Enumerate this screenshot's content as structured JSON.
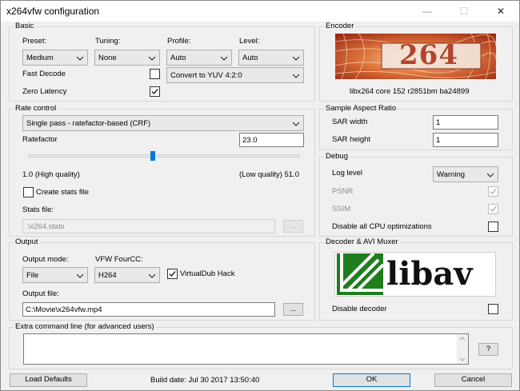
{
  "window": {
    "title": "x264vfw configuration",
    "minimize_glyph": "—",
    "maximize_glyph": "☐",
    "close_glyph": "✕"
  },
  "basic": {
    "title": "Basic",
    "preset_label": "Preset:",
    "preset_value": "Medium",
    "tuning_label": "Tuning:",
    "tuning_value": "None",
    "profile_label": "Profile:",
    "profile_value": "Auto",
    "level_label": "Level:",
    "level_value": "Auto",
    "fast_decode_label": "Fast Decode",
    "fast_decode_checked": false,
    "zero_latency_label": "Zero Latency",
    "zero_latency_checked": true,
    "colorspace_value": "Convert to YUV 4:2:0"
  },
  "encoder": {
    "title": "Encoder",
    "logo_text": "264",
    "version_text": "libx264 core 152 r2851bm ba24899"
  },
  "rate_control": {
    "title": "Rate control",
    "mode_value": "Single pass - ratefactor-based (CRF)",
    "ratefactor_label": "Ratefactor",
    "ratefactor_value": "23.0",
    "slider_level": 0.46,
    "min_label": "1.0 (High quality)",
    "max_label": "(Low quality) 51.0",
    "create_stats_label": "Create stats file",
    "create_stats_checked": false,
    "stats_file_label": "Stats file:",
    "stats_file_value": ".\\x264.stats",
    "browse_label": "..."
  },
  "sar": {
    "title": "Sample Aspect Ratio",
    "width_label": "SAR width",
    "width_value": "1",
    "height_label": "SAR height",
    "height_value": "1"
  },
  "debug": {
    "title": "Debug",
    "log_level_label": "Log level",
    "log_level_value": "Warning",
    "psnr_label": "PSNR",
    "psnr_checked": true,
    "ssim_label": "SSIM",
    "ssim_checked": true,
    "disable_cpu_label": "Disable all CPU optimizations",
    "disable_cpu_checked": false
  },
  "output": {
    "title": "Output",
    "mode_label": "Output mode:",
    "mode_value": "File",
    "fourcc_label": "VFW FourCC:",
    "fourcc_value": "H264",
    "vdub_label": "VirtualDub Hack",
    "vdub_checked": true,
    "file_label": "Output file:",
    "file_value": "C:\\Movie\\x264vfw.mp4",
    "browse_label": "..."
  },
  "decoder": {
    "title": "Decoder & AVI Muxer",
    "logo_text": "libav",
    "disable_label": "Disable decoder",
    "disable_checked": false
  },
  "extra": {
    "title": "Extra command line (for advanced users)",
    "value": "",
    "help_label": "?"
  },
  "footer": {
    "load_defaults_label": "Load Defaults",
    "build_date": "Build date: Jul 30 2017 13:50:40",
    "ok_label": "OK",
    "cancel_label": "Cancel"
  },
  "colors": {
    "window_bg": "#f0f0f0",
    "accent": "#0078d7",
    "logo_red": "#b5422e",
    "logo_green": "#1f7d1c"
  }
}
